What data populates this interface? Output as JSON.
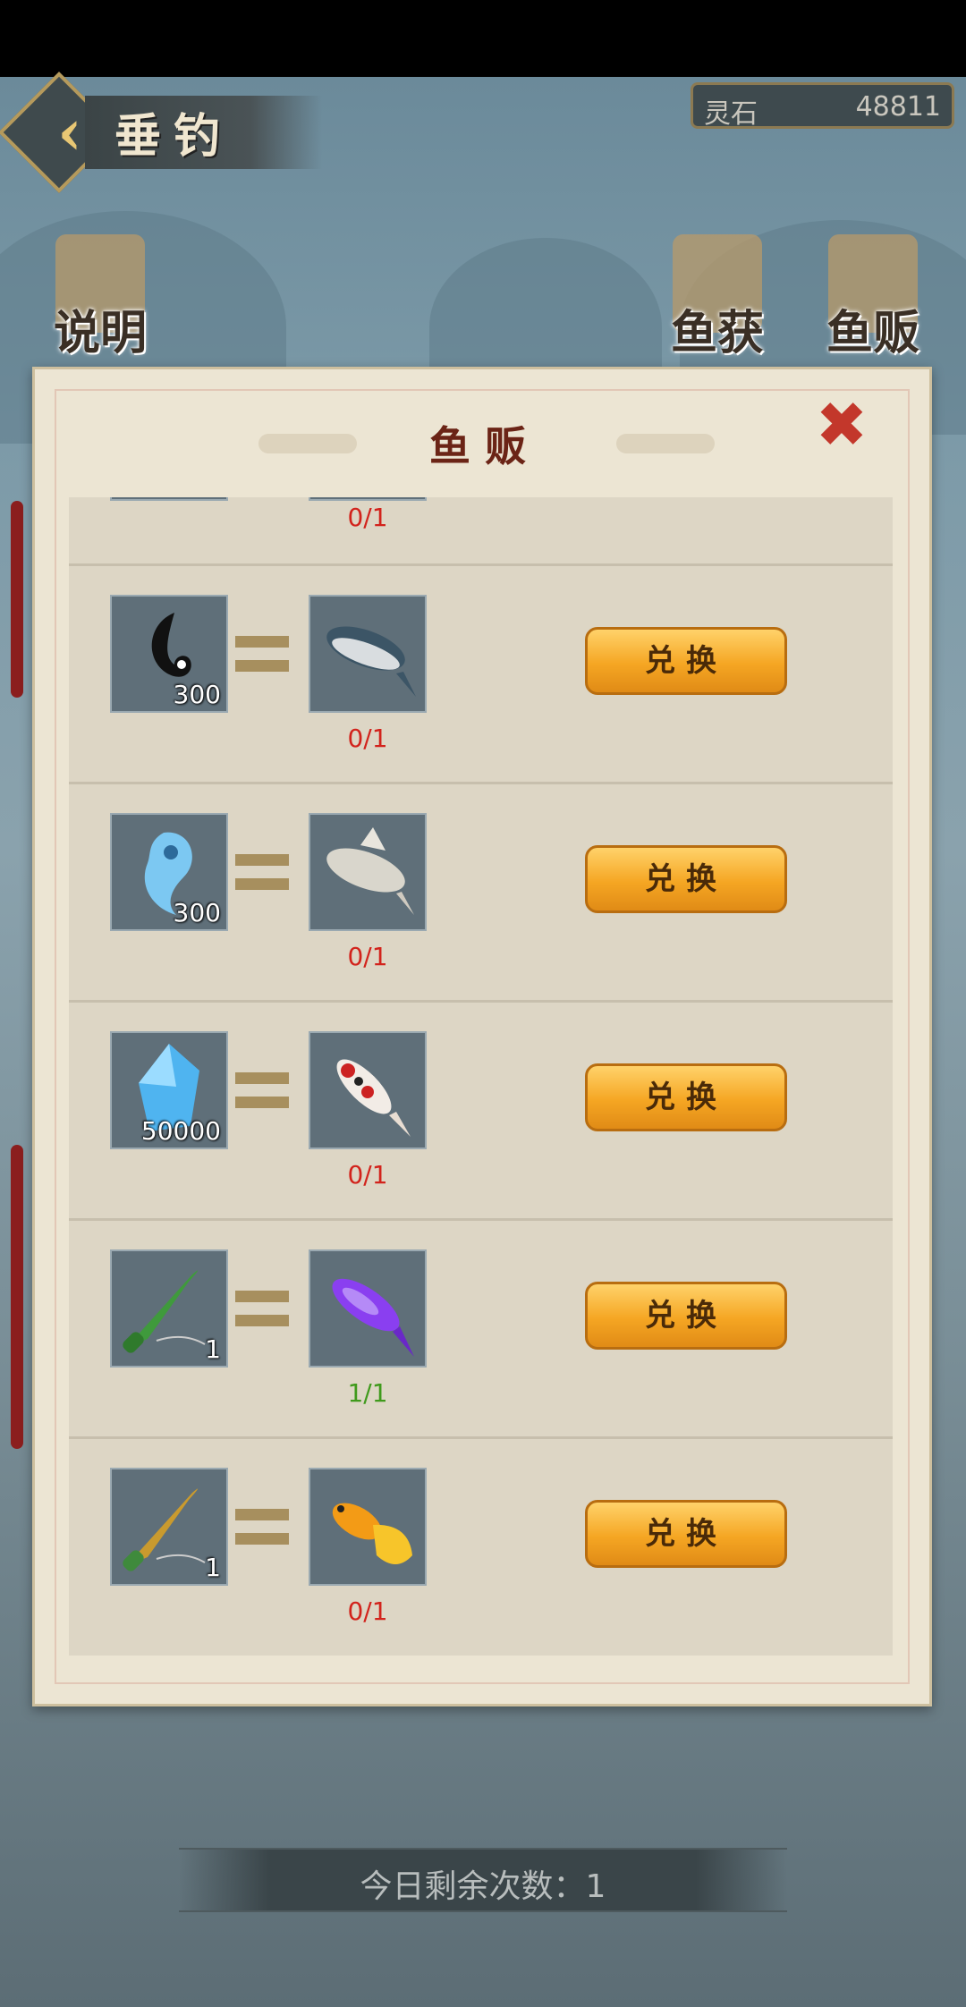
{
  "header": {
    "title": "垂钓",
    "currency_label": "灵石",
    "currency_value": "48811"
  },
  "side_buttons": {
    "help": "说明",
    "catch": "鱼获",
    "vendor": "鱼贩"
  },
  "modal": {
    "title": "鱼贩",
    "partial_progress": "0/1",
    "rows": [
      {
        "cost_icon": "black-magatama-icon",
        "cost_count": "300",
        "reward_icon": "zander-fish-icon",
        "progress": "0/1",
        "button": "兑换"
      },
      {
        "cost_icon": "blue-magatama-icon",
        "cost_count": "300",
        "reward_icon": "white-perch-fish-icon",
        "progress": "0/1",
        "button": "兑换"
      },
      {
        "cost_icon": "blue-crystal-icon",
        "cost_count": "50000",
        "reward_icon": "koi-fish-icon",
        "progress": "0/1",
        "button": "兑换"
      },
      {
        "cost_icon": "jade-fishing-rod-icon",
        "cost_count": "1",
        "reward_icon": "purple-arowana-icon",
        "progress": "1/1",
        "button": "兑换"
      },
      {
        "cost_icon": "golden-fishing-rod-icon",
        "cost_count": "1",
        "reward_icon": "golden-betta-fish-icon",
        "progress": "0/1",
        "button": "兑换"
      }
    ]
  },
  "footer": {
    "remaining_today": "今日剩余次数：1"
  },
  "colors": {
    "progress_incomplete": "#d2231c",
    "progress_complete": "#3f9a1c",
    "button": "#f5a623"
  }
}
